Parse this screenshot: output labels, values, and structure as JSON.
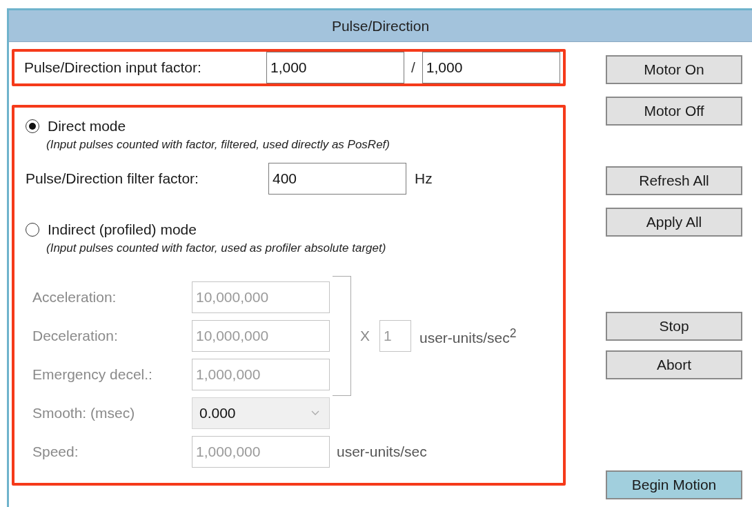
{
  "window": {
    "title": "Pulse/Direction"
  },
  "input_factor": {
    "label": "Pulse/Direction input factor:",
    "numerator": "1,000",
    "separator": "/",
    "denominator": "1,000"
  },
  "modes": [
    {
      "label": "Direct mode",
      "selected": true,
      "description": "(Input pulses counted with factor, filtered, used directly as PosRef)"
    },
    {
      "label": "Indirect (profiled) mode",
      "selected": false,
      "description": "(Input pulses counted with factor, used as profiler absolute target)"
    }
  ],
  "filter": {
    "label": "Pulse/Direction filter factor:",
    "value": "400",
    "unit": "Hz"
  },
  "profile": {
    "disabled": true,
    "rows": [
      {
        "kind": "input",
        "label": "Acceleration:",
        "value": "10,000,000"
      },
      {
        "kind": "input",
        "label": "Deceleration:",
        "value": "10,000,000"
      },
      {
        "kind": "input",
        "label": "Emergency decel.:",
        "value": "1,000,000"
      },
      {
        "kind": "select",
        "label": "Smooth: (msec)",
        "value": "0.000"
      },
      {
        "kind": "input",
        "label": "Speed:",
        "value": "1,000,000",
        "unit": "user-units/sec"
      }
    ],
    "multiplier": {
      "sign": "X",
      "value": "1",
      "unit": "user-units/sec$^{2}$"
    }
  },
  "buttons": [
    {
      "label": "Motor On",
      "highlighted": false
    },
    {
      "label": "Motor Off",
      "highlighted": false
    },
    {
      "label": "Refresh All",
      "highlighted": false
    },
    {
      "label": "Apply All",
      "highlighted": false
    },
    {
      "label": "Stop",
      "highlighted": false
    },
    {
      "label": "Abort",
      "highlighted": false
    },
    {
      "label": "Begin Motion",
      "highlighted": true
    }
  ]
}
